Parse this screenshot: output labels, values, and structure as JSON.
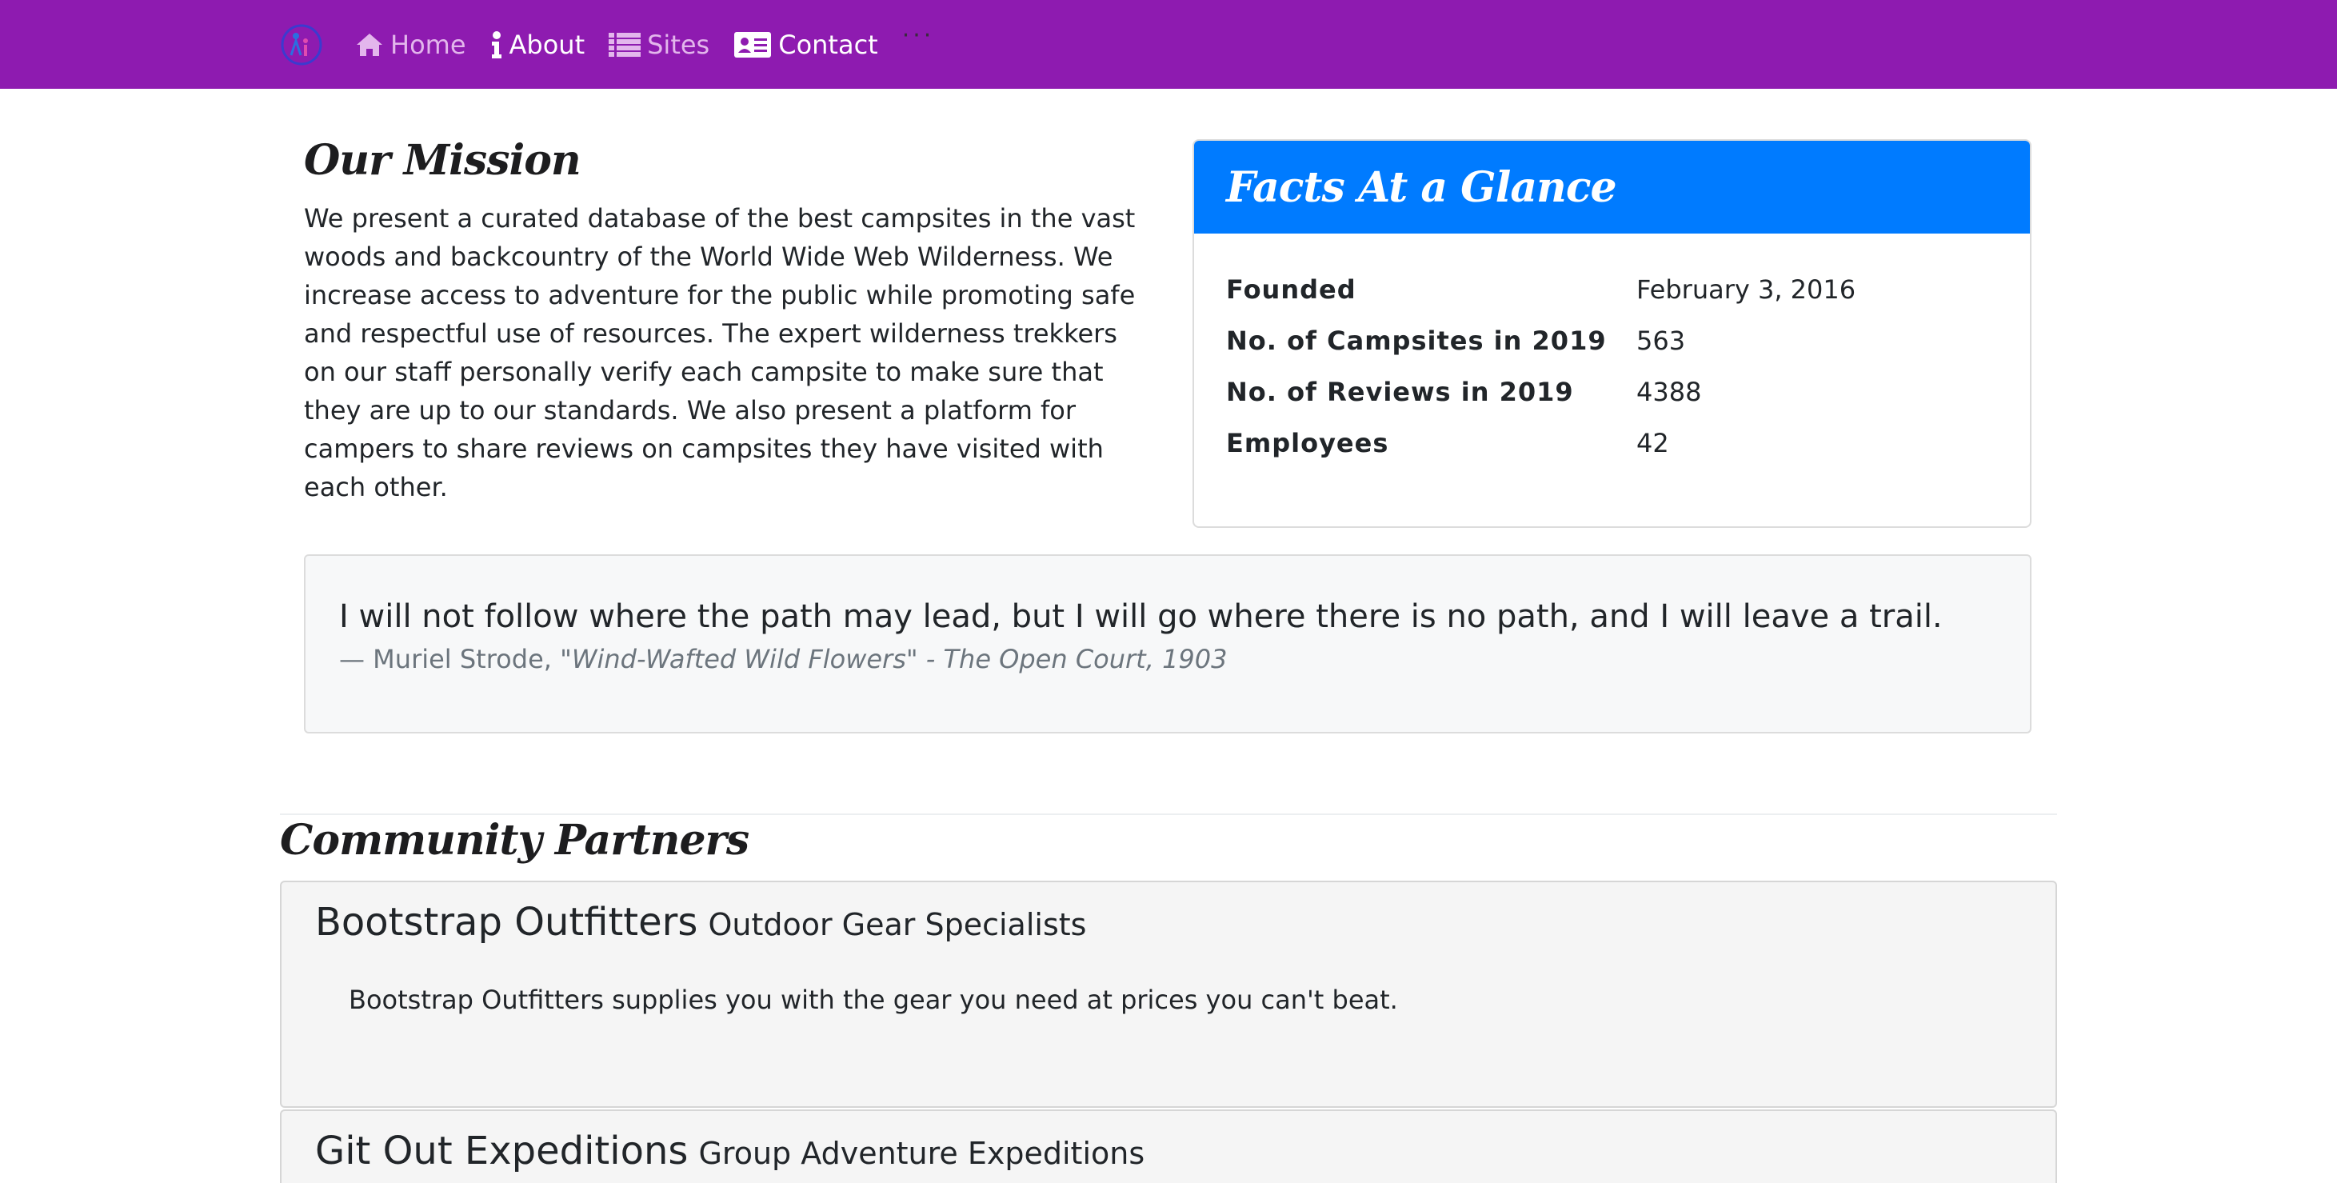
{
  "nav": {
    "items": [
      {
        "label": "Home",
        "icon": "home-icon",
        "state": "inactive"
      },
      {
        "label": "About",
        "icon": "info-icon",
        "state": "active"
      },
      {
        "label": "Sites",
        "icon": "list-icon",
        "state": "inactive"
      },
      {
        "label": "Contact",
        "icon": "contact-card-icon",
        "state": "active"
      }
    ],
    "overflow": "···",
    "background": "#8e1bb0"
  },
  "mission": {
    "title": "Our Mission",
    "body": "We present a curated database of the best campsites in the vast woods and backcountry of the World Wide Web Wilderness. We increase access to adventure for the public while promoting safe and respectful use of resources. The expert wilderness trekkers on our staff personally verify each campsite to make sure that they are up to our standards. We also present a platform for campers to share reviews on campsites they have visited with each other."
  },
  "facts": {
    "title": "Facts At a Glance",
    "header_color": "#007bff",
    "rows": [
      {
        "label": "Founded",
        "value": "February 3, 2016"
      },
      {
        "label": "No. of Campsites in 2019",
        "value": "563"
      },
      {
        "label": "No. of Reviews in 2019",
        "value": "4388"
      },
      {
        "label": "Employees",
        "value": "42"
      }
    ]
  },
  "quote": {
    "text": "I will not follow where the path may lead, but I will go where there is no path, and I will leave a trail.",
    "author": "— Muriel Strode,",
    "source": "\"Wind-Wafted Wild Flowers\" - The Open Court, 1903"
  },
  "partners": {
    "title": "Community Partners",
    "items": [
      {
        "name": "Bootstrap Outfitters",
        "subtitle": "Outdoor Gear Specialists",
        "description": "Bootstrap Outfitters supplies you with the gear you need at prices you can't beat."
      },
      {
        "name": "Git Out Expeditions",
        "subtitle": "Group Adventure Expeditions",
        "description": ""
      }
    ]
  }
}
